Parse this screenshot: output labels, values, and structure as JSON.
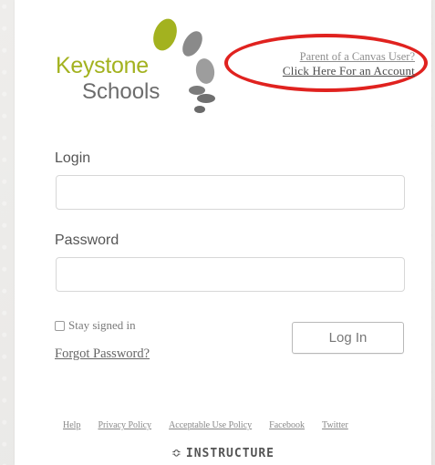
{
  "logo": {
    "line1": "Keystone",
    "line2": "Schools",
    "colors": {
      "green": "#a3b21f",
      "grey": "#6c6c6c"
    }
  },
  "parent_link": {
    "line1": "Parent of a Canvas User?",
    "line2": "Click Here For an Account"
  },
  "form": {
    "login_label": "Login",
    "login_value": "",
    "password_label": "Password",
    "password_value": "",
    "stay_signed_in_label": "Stay signed in",
    "stay_signed_in_checked": false,
    "forgot_password": "Forgot Password?",
    "login_button": "Log In"
  },
  "footer": {
    "links": [
      "Help",
      "Privacy Policy",
      "Acceptable Use Policy",
      "Facebook",
      "Twitter"
    ],
    "brand": "INSTRUCTURE"
  },
  "annotation_color": "#e0221f"
}
